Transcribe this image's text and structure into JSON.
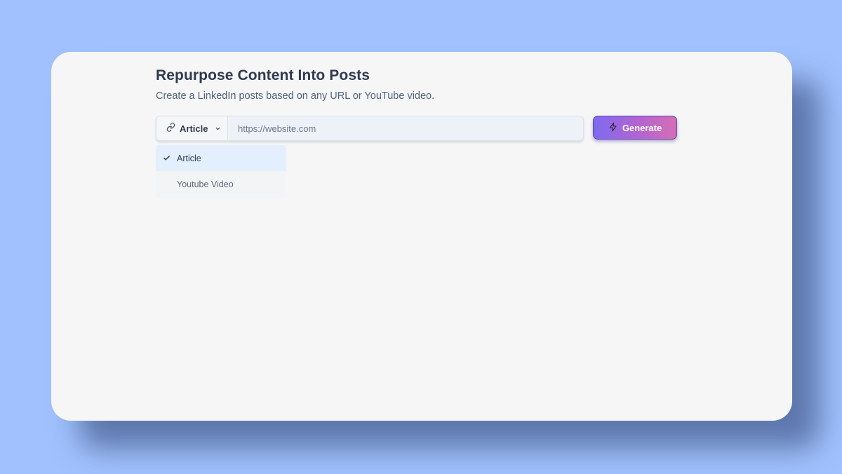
{
  "page": {
    "title": "Repurpose Content Into Posts",
    "subtitle": "Create a LinkedIn posts based on any URL or YouTube video."
  },
  "form": {
    "type_select": {
      "selected": "Article",
      "icon": "link-icon",
      "caret_icon": "chevron-down-icon"
    },
    "url_input": {
      "value": "",
      "placeholder": "https://website.com"
    },
    "generate_button": {
      "label": "Generate",
      "icon": "lightning-icon"
    }
  },
  "dropdown": {
    "options": [
      {
        "label": "Article",
        "selected": true
      },
      {
        "label": "Youtube Video",
        "selected": false
      }
    ]
  },
  "colors": {
    "background": "#a0c1fd",
    "card": "#f6f6f7",
    "title": "#2f3a4f",
    "subtitle": "#526079",
    "button_gradient_start": "#7d6bf0",
    "button_gradient_end": "#d46fb4",
    "selected_option": "#e4effd"
  }
}
